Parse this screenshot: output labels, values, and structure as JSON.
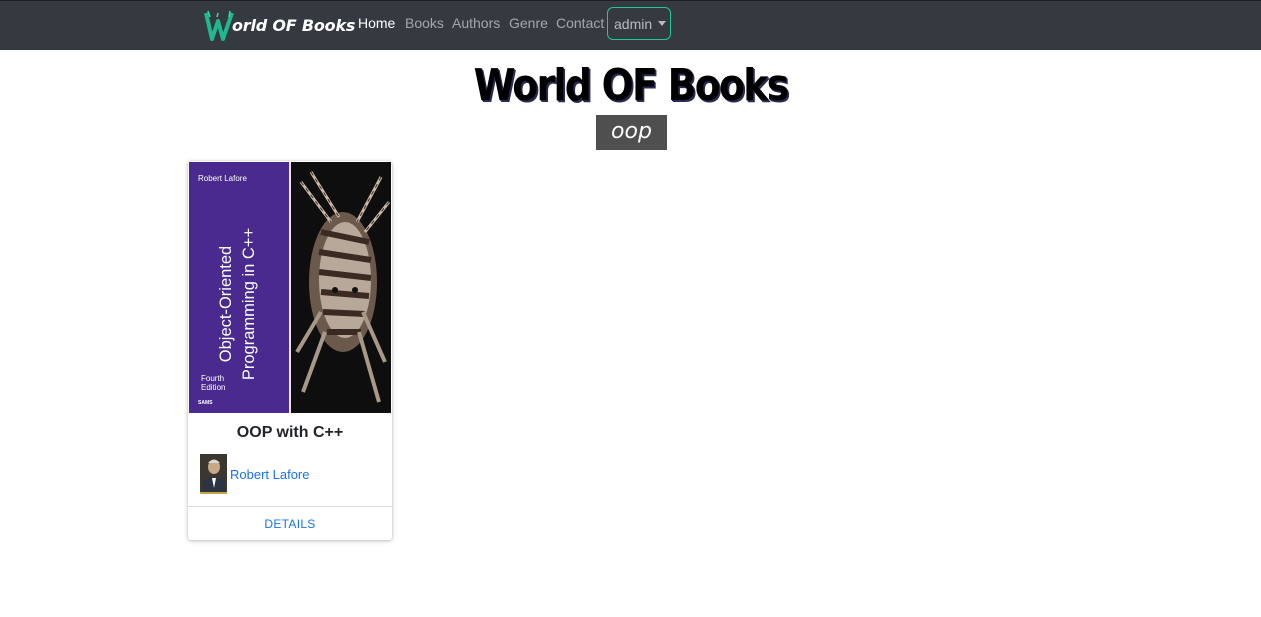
{
  "navbar": {
    "brand_letter": "W",
    "brand_rest": "orld OF Books",
    "links": [
      "Home",
      "Books",
      "Authors",
      "Genre",
      "Contact"
    ],
    "active_index": 0,
    "user_dropdown": "admin",
    "accent_color": "#20c997"
  },
  "header": {
    "title": "World OF Books",
    "genre_badge": "oop"
  },
  "books": [
    {
      "title": "OOP with C++",
      "author": "Robert Lafore",
      "action": "DETAILS",
      "cover": {
        "author": "Robert Lafore",
        "title_line1": "Object-Oriented",
        "title_line2": "Programming in C++",
        "edition_line1": "Fourth",
        "edition_line2": "Edition",
        "publisher": "SAMS",
        "color": "#4a2a8e"
      }
    }
  ]
}
